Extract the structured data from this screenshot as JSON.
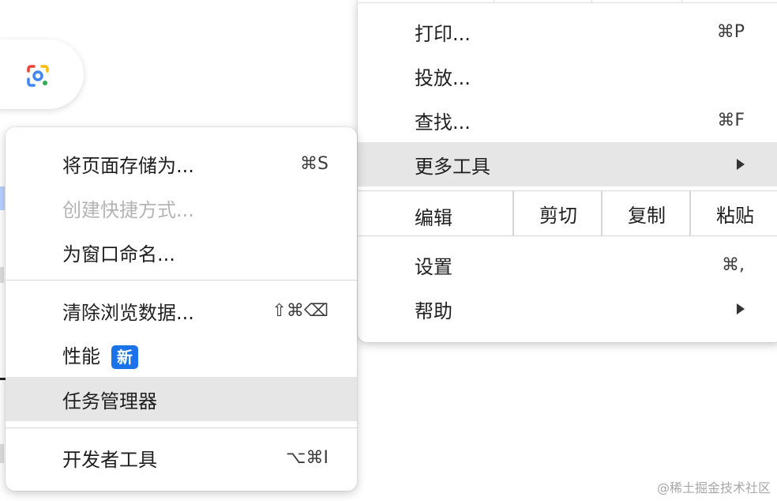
{
  "main_menu": {
    "items": [
      {
        "label": "打印...",
        "shortcut": "⌘P"
      },
      {
        "label": "投放...",
        "shortcut": ""
      },
      {
        "label": "查找...",
        "shortcut": "⌘F"
      },
      {
        "label": "更多工具",
        "shortcut": ""
      }
    ],
    "edit": {
      "label": "编辑",
      "cut": "剪切",
      "copy": "复制",
      "paste": "粘贴"
    },
    "settings": {
      "label": "设置",
      "shortcut": "⌘,"
    },
    "help": {
      "label": "帮助"
    }
  },
  "sub_menu": {
    "items": [
      {
        "label": "将页面存储为...",
        "shortcut": "⌘S"
      },
      {
        "label": "创建快捷方式...",
        "shortcut": ""
      },
      {
        "label": "为窗口命名...",
        "shortcut": ""
      },
      {
        "label": "清除浏览数据...",
        "shortcut": "⇧⌘⌫"
      },
      {
        "label": "性能",
        "badge": "新"
      },
      {
        "label": "任务管理器",
        "shortcut": ""
      },
      {
        "label": "开发者工具",
        "shortcut": "⌥⌘I"
      }
    ]
  },
  "watermark": "@稀土掘金技术社区",
  "icons": {
    "lens": "google-lens-icon",
    "submenu_arrow": "chevron-right-icon"
  },
  "colors": {
    "highlight": "#e6e6e6",
    "badge": "#1a73e8"
  }
}
